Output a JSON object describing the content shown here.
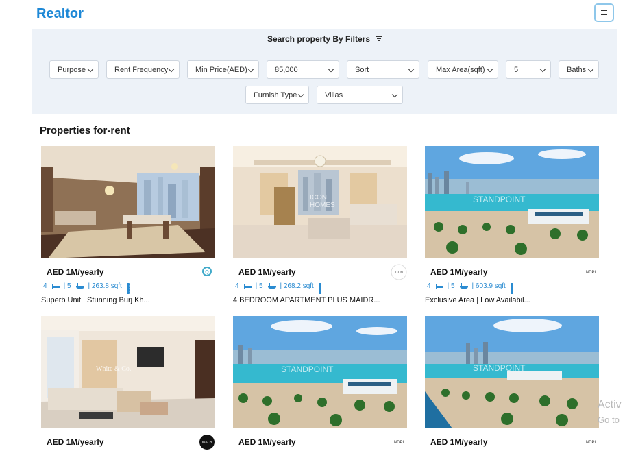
{
  "header": {
    "brand": "Realtor",
    "menu_icon": "hamburger-icon"
  },
  "filters": {
    "title": "Search property By Filters",
    "icon": "filter-icon",
    "row1": [
      {
        "label": "Purpose"
      },
      {
        "label": "Rent Frequency"
      },
      {
        "label": "Min Price(AED)"
      },
      {
        "label": "85,000"
      },
      {
        "label": "Sort"
      },
      {
        "label": "Max Area(sqft)"
      },
      {
        "label": "5"
      },
      {
        "label": "Baths"
      }
    ],
    "row2": [
      {
        "label": "Furnish Type"
      },
      {
        "label": "Villas"
      }
    ]
  },
  "section": {
    "title": "Properties for-rent"
  },
  "listings": [
    {
      "price": "AED 1M/yearly",
      "rooms": "4",
      "baths": "5",
      "area": "| 263.8 sqft",
      "title": "Superb Unit | Stunning Burj Kh...",
      "logo": "Q"
    },
    {
      "price": "AED 1M/yearly",
      "rooms": "4",
      "baths": "5",
      "area": "| 268.2 sqft",
      "title": "4 BEDROOM APARTMENT PLUS MAIDR...",
      "logo": "ICON"
    },
    {
      "price": "AED 1M/yearly",
      "rooms": "4",
      "baths": "5",
      "area": "| 603.9 sqft",
      "title": "Exclusive Area | Low Availabil...",
      "logo": "NDPI"
    },
    {
      "price": "AED 1M/yearly",
      "logo": "W&Co"
    },
    {
      "price": "AED 1M/yearly",
      "logo": "NDPI"
    },
    {
      "price": "AED 1M/yearly",
      "logo": "NDPI"
    }
  ],
  "overlay": {
    "line1": "Activ",
    "line2": "Go to"
  },
  "colors": {
    "brand": "#1e88d6",
    "accent": "#2a8bd1",
    "filter_bg": "#edf2f8"
  }
}
